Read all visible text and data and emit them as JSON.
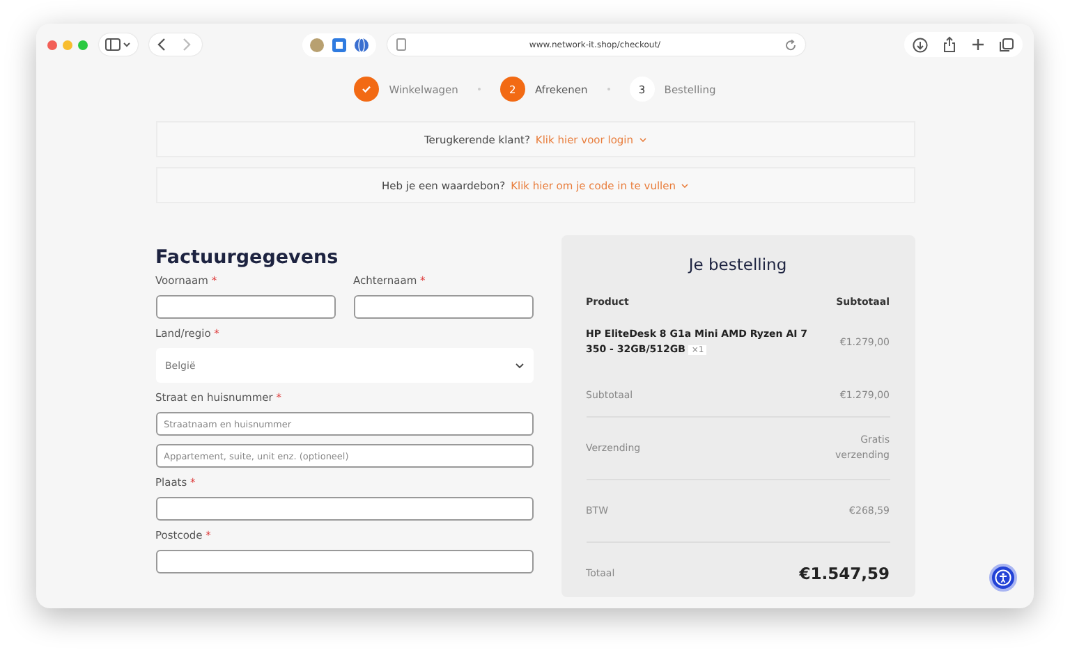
{
  "browser": {
    "url": "www.network-it.shop/checkout/"
  },
  "steps": [
    {
      "completed": true,
      "selected": false,
      "label": "Winkelwagen"
    },
    {
      "completed": false,
      "selected": true,
      "number": "2",
      "label": "Afrekenen"
    },
    {
      "completed": false,
      "selected": false,
      "number": "3",
      "label": "Bestelling"
    }
  ],
  "notices": [
    {
      "text": "Terugkerende klant?",
      "link": "Klik hier voor login"
    },
    {
      "text": "Heb je een waardebon?",
      "link": "Klik hier om je code in te vullen"
    }
  ],
  "billing": {
    "title": "Factuurgegevens",
    "fields": [
      {
        "kind": "pair",
        "fields": [
          {
            "label": "Voornaam",
            "mark": "*"
          },
          {
            "label": "Achternaam",
            "mark": "*"
          }
        ]
      },
      {
        "kind": "select",
        "label": "Land/regio",
        "mark": "*",
        "value": "België"
      },
      {
        "kind": "group",
        "label": "Straat en huisnummer",
        "mark": "*",
        "inputs": [
          {
            "placeholder": "Straatnaam en huisnummer"
          },
          {
            "placeholder": "Appartement, suite, unit enz. (optioneel)"
          }
        ]
      },
      {
        "kind": "text",
        "label": "Plaats",
        "mark": "*"
      },
      {
        "kind": "text",
        "label": "Postcode",
        "mark": "*"
      }
    ]
  },
  "order": {
    "title": "Je bestelling",
    "columns": [
      "Product",
      "Subtotaal"
    ],
    "items": [
      {
        "name": "HP EliteDesk 8 G1a Mini AMD Ryzen AI 7 350 - 32GB/512GB",
        "quantity": "×1",
        "price": "€1.279,00"
      }
    ],
    "rows": [
      {
        "label": "Subtotaal",
        "value": "€1.279,00"
      },
      {
        "label": "Verzending",
        "value": "Gratis verzending"
      },
      {
        "label": "BTW",
        "value": "€268,59"
      }
    ],
    "total": {
      "label": "Totaal",
      "value": "€1.547,59"
    }
  }
}
